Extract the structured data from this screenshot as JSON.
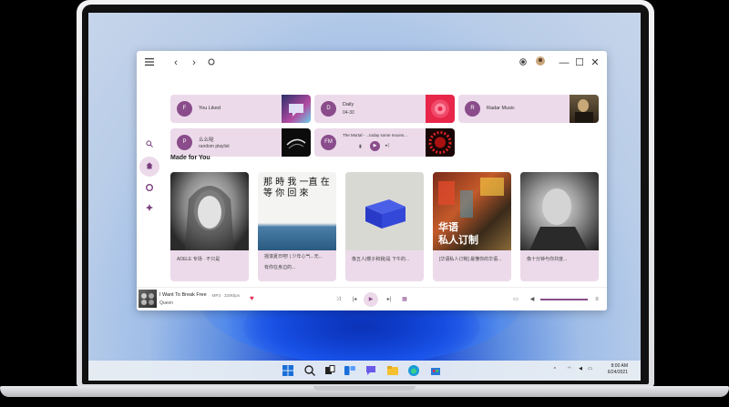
{
  "window": {
    "menu_icon": "hamburger-icon",
    "back_icon": "chevron-left-icon",
    "forward_icon": "chevron-right-icon",
    "refresh_icon": "refresh-icon"
  },
  "titlebar_right": {
    "glyph_min": "—",
    "glyph_max": "☐",
    "glyph_close": "✕"
  },
  "top_cards": [
    {
      "avatar": "F",
      "title": "You Liked",
      "subtitle": ""
    },
    {
      "avatar": "D",
      "title": "Daily",
      "subtitle": "04-30"
    },
    {
      "avatar": "R",
      "title": "Radar Music",
      "subtitle": ""
    },
    {
      "avatar": "P",
      "title": "么么哒",
      "subtitle": "random playlist"
    },
    {
      "avatar": "FM",
      "title": "The Mortal - ...today some moons...",
      "subtitle": ""
    }
  ],
  "section_title": "Made for You",
  "made_for_you": [
    {
      "caption1": "ADELE 专场 · 不只是",
      "caption2": ""
    },
    {
      "caption1": "摇滚夏日吧! | 少年心气...无...",
      "caption2": "有你在身边的..."
    },
    {
      "caption1": "像五人|樱子和我|是 下午的...",
      "caption2": ""
    },
    {
      "caption1": "[华语私人订制] 最懂你的华语...",
      "caption2": ""
    },
    {
      "caption1": "像十分钟与你共度...",
      "caption2": ""
    }
  ],
  "cover4_text": {
    "line1": "华语",
    "line2": "私人订制"
  },
  "cover2_text": "那 時 我 一直 在 等 你 回 來",
  "player": {
    "track": "I Want To Break Free",
    "meta": "· MP3 · 320kbps",
    "artist": "Queen"
  },
  "taskbar": {
    "time": "8:00 AM",
    "date": "6/24/2021"
  },
  "colors": {
    "accent": "#8a4c8b",
    "card_bg": "#ecdaea"
  }
}
